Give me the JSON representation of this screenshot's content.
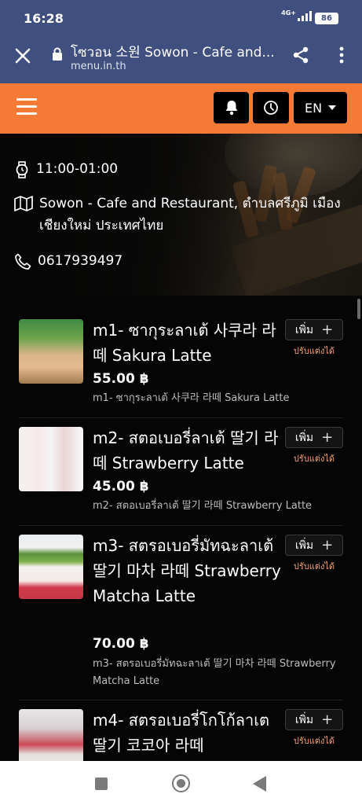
{
  "status_bar": {
    "time": "16:28",
    "network": "4G+",
    "battery": "86"
  },
  "browser": {
    "page_title": "โซวอน 소원 Sowon - Cafe and...",
    "domain": "menu.in.th"
  },
  "navbar": {
    "language": "EN",
    "accent_color": "#f47a35"
  },
  "restaurant": {
    "hours": "11:00-01:00",
    "address": "Sowon - Cafe and Restaurant, ตำบลศรีภูมิ เมือง เชียงใหม่ ประเทศไทย",
    "phone": "0617939497"
  },
  "menu": {
    "items": [
      {
        "name": "m1- ซากุระลาเต้ 사쿠라 라떼 Sakura Latte",
        "price": "55.00 ฿",
        "description": "m1- ซากุระลาเต้ 사쿠라 라떼 Sakura Latte",
        "add_label": "เพิ่ม",
        "customize_label": "ปรับแต่งได้"
      },
      {
        "name": "m2- สตอเบอรี่ลาเต้ 딸기 라떼 Strawberry Latte",
        "price": "45.00 ฿",
        "description": "m2- สตอเบอรี่ลาเต้ 딸기 라떼 Strawberry Latte",
        "add_label": "เพิ่ม",
        "customize_label": "ปรับแต่งได้"
      },
      {
        "name": "m3- สตรอเบอรี่มัทฉะลาเต้ 딸기 마차 라떼 Strawberry Matcha Latte",
        "price": "70.00 ฿",
        "description": "m3- สตรอเบอรี่มัทฉะลาเต้ 딸기 마차 라떼 Strawberry Matcha Latte",
        "add_label": "เพิ่ม",
        "customize_label": "ปรับแต่งได้"
      },
      {
        "name": "m4- สตรอเบอรี่โกโก้ลาเต 딸기 코코아 라떼",
        "price": "",
        "description": "",
        "add_label": "เพิ่ม",
        "customize_label": "ปรับแต่งได้"
      }
    ]
  }
}
